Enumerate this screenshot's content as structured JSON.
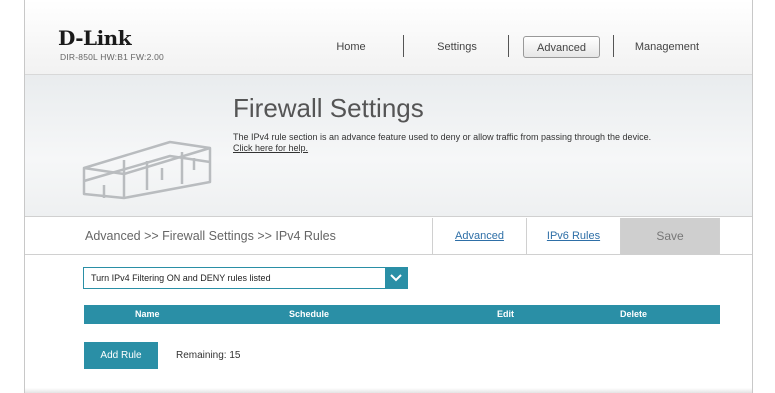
{
  "header": {
    "logo": "D-Link",
    "model": "DIR-850L   HW:B1   FW:2.00",
    "nav": [
      {
        "label": "Home"
      },
      {
        "label": "Settings"
      },
      {
        "label": "Advanced"
      },
      {
        "label": "Management"
      }
    ],
    "active_nav": "Advanced"
  },
  "banner": {
    "title": "Firewall Settings",
    "description": "The IPv4 rule section is an advance feature used to deny or allow traffic from passing through the device.",
    "help_link": "Click here for help."
  },
  "breadcrumb": "Advanced >> Firewall Settings >> IPv4 Rules",
  "tabs": {
    "advanced": "Advanced",
    "ipv6_rules": "IPv6 Rules",
    "save": "Save"
  },
  "filter_select": {
    "value": "Turn IPv4 Filtering ON and DENY rules listed"
  },
  "table": {
    "columns": [
      "Name",
      "Schedule",
      "Edit",
      "Delete"
    ]
  },
  "add_rule": {
    "label": "Add Rule",
    "remaining_label": "Remaining: 15"
  },
  "colors": {
    "accent": "#2a8fa6",
    "save_bg": "#cfcfcf"
  }
}
